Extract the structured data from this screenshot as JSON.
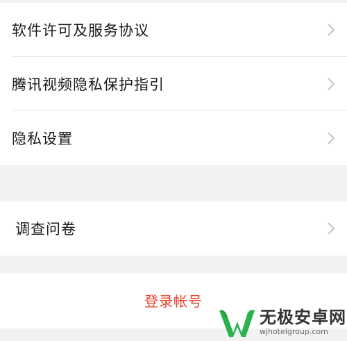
{
  "settings": {
    "items": [
      {
        "label": "软件许可及服务协议"
      },
      {
        "label": "腾讯视频隐私保护指引"
      },
      {
        "label": "隐私设置"
      }
    ],
    "survey": {
      "label": "调查问卷"
    },
    "logout": {
      "label": "登录帐号"
    }
  },
  "watermark": {
    "title": "无极安卓网",
    "url": "wjhotelgroup.com"
  },
  "colors": {
    "background": "#f2f2f4",
    "text": "#1a1a1a",
    "chevron": "#c4c4c8",
    "logout": "#e8432f",
    "logo_green": "#2bb24c"
  }
}
